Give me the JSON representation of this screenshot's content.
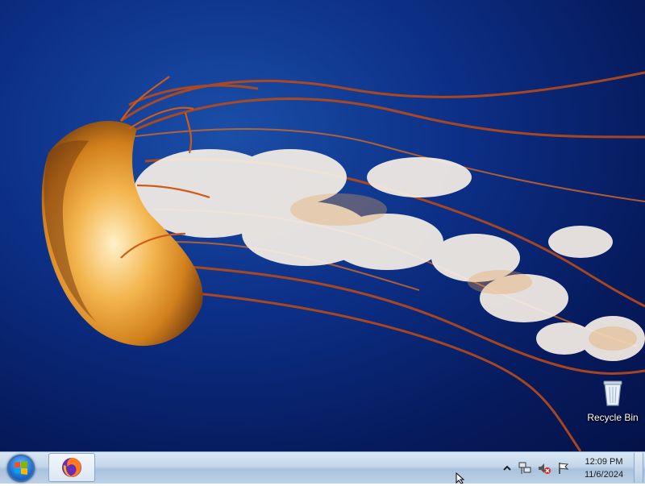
{
  "desktop": {
    "wallpaper": "jellyfish",
    "icons": [
      {
        "label": "Recycle Bin",
        "icon": "recycle-bin-icon"
      }
    ]
  },
  "taskbar": {
    "start_icon": "windows-logo-icon",
    "pinned": [
      {
        "app": "Firefox",
        "icon": "firefox-icon"
      }
    ],
    "tray": {
      "icons": [
        "show-hidden-icons-chevron",
        "network-icon",
        "volume-muted-icon",
        "action-center-flag-icon"
      ]
    },
    "clock": {
      "time": "12:09 PM",
      "date": "11/6/2024"
    }
  },
  "colors": {
    "desktop_bg": "#0c2f86",
    "taskbar": "#c3d6ea",
    "jellyfish_bell": "#e89a2a",
    "tentacles": "#b84818"
  }
}
